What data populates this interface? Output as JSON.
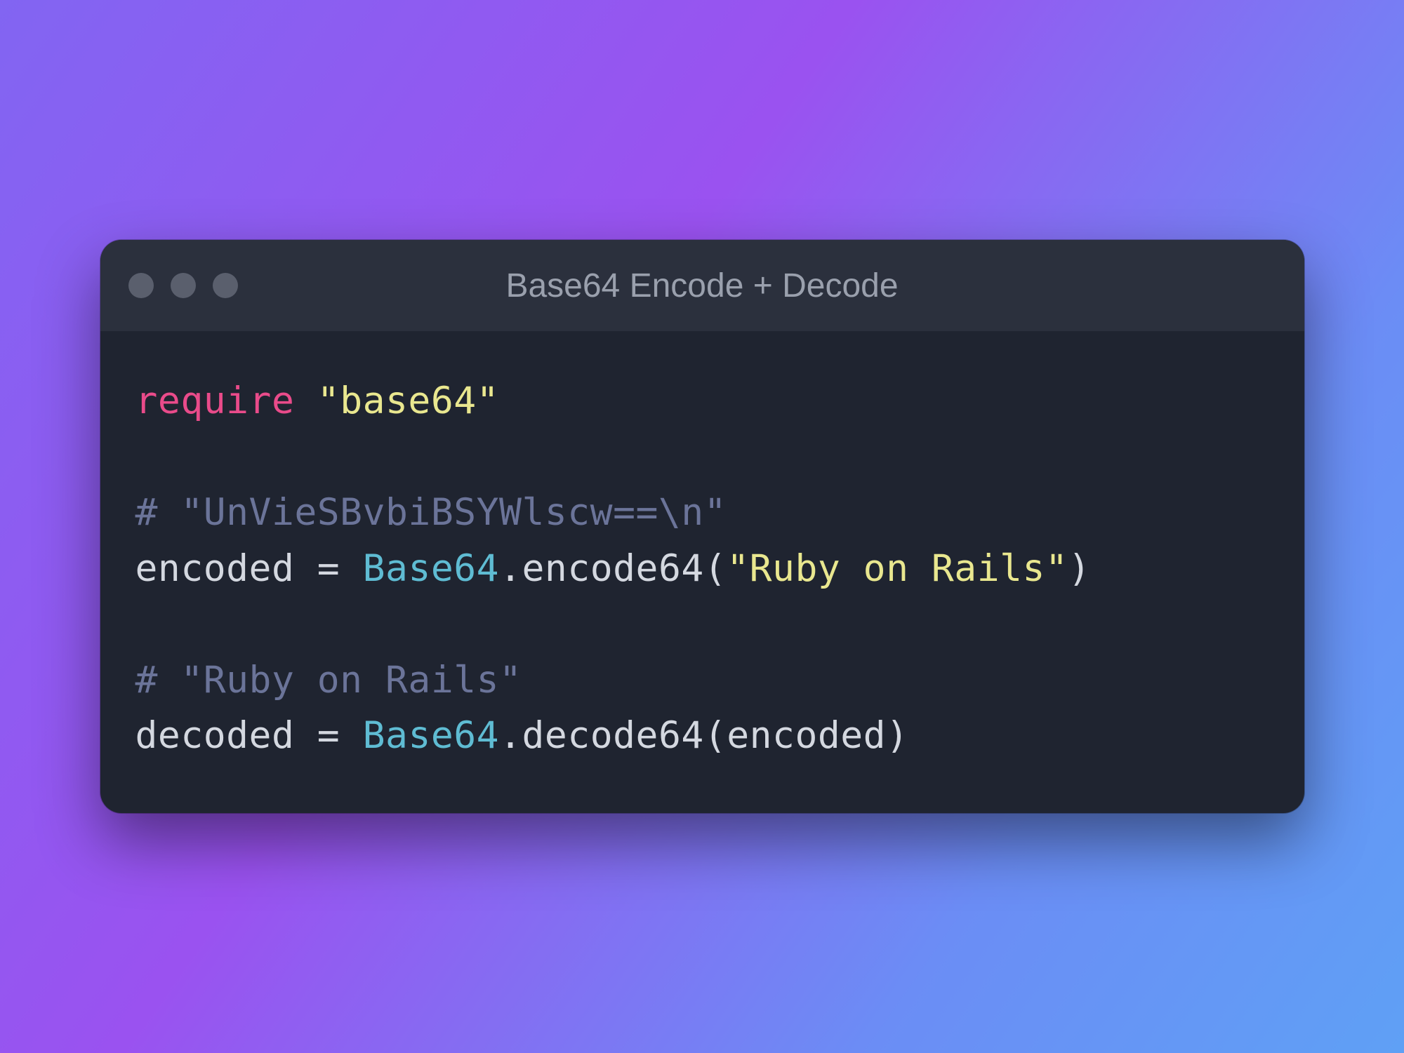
{
  "window": {
    "title": "Base64 Encode + Decode"
  },
  "code": {
    "line1_keyword": "require",
    "line1_space": " ",
    "line1_string": "\"base64\"",
    "blank1": "",
    "line2_comment": "# \"UnVieSBvbiBSYWlscw==\\n\"",
    "line3_var": "encoded",
    "line3_sp1": " ",
    "line3_op": "=",
    "line3_sp2": " ",
    "line3_class": "Base64",
    "line3_dot": ".",
    "line3_method": "encode64",
    "line3_open": "(",
    "line3_arg": "\"Ruby on Rails\"",
    "line3_close": ")",
    "blank2": "",
    "line4_comment": "# \"Ruby on Rails\"",
    "line5_var": "decoded",
    "line5_sp1": " ",
    "line5_op": "=",
    "line5_sp2": " ",
    "line5_class": "Base64",
    "line5_dot": ".",
    "line5_method": "decode64",
    "line5_open": "(",
    "line5_arg": "encoded",
    "line5_close": ")"
  }
}
